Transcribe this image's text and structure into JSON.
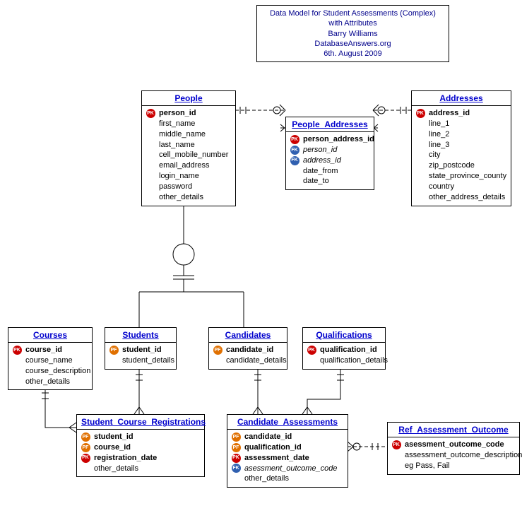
{
  "title": {
    "line1": "Data Model for Student Assessments (Complex)",
    "line2": "with Attributes",
    "line3": "Barry Williams",
    "line4": "DatabaseAnswers.org",
    "line5": "6th. August 2009"
  },
  "entities": {
    "people": {
      "name": "People",
      "attrs": {
        "a0": "person_id",
        "a1": "first_name",
        "a2": "middle_name",
        "a3": "last_name",
        "a4": "cell_mobile_number",
        "a5": "email_address",
        "a6": "login_name",
        "a7": "password",
        "a8": "other_details"
      }
    },
    "people_addresses": {
      "name": "People_Addresses",
      "attrs": {
        "a0": "person_address_id",
        "a1": "person_id",
        "a2": "address_id",
        "a3": "date_from",
        "a4": "date_to"
      }
    },
    "addresses": {
      "name": "Addresses",
      "attrs": {
        "a0": "address_id",
        "a1": "line_1",
        "a2": "line_2",
        "a3": "line_3",
        "a4": "city",
        "a5": "zip_postcode",
        "a6": "state_province_county",
        "a7": "country",
        "a8": "other_address_details"
      }
    },
    "courses": {
      "name": "Courses",
      "attrs": {
        "a0": "course_id",
        "a1": "course_name",
        "a2": "course_description",
        "a3": "other_details"
      }
    },
    "students": {
      "name": "Students",
      "attrs": {
        "a0": "student_id",
        "a1": "student_details"
      }
    },
    "candidates": {
      "name": "Candidates",
      "attrs": {
        "a0": "candidate_id",
        "a1": "candidate_details"
      }
    },
    "qualifications": {
      "name": "Qualifications",
      "attrs": {
        "a0": "qualification_id",
        "a1": "qualification_details"
      }
    },
    "scr": {
      "name": "Student_Course_Registrations",
      "attrs": {
        "a0": "student_id",
        "a1": "course_id",
        "a2": "registration_date",
        "a3": "other_details"
      }
    },
    "ca": {
      "name": "Candidate_Assessments",
      "attrs": {
        "a0": "candidate_id",
        "a1": "qualification_id",
        "a2": "assessment_date",
        "a3": "asessment_outcome_code",
        "a4": "other_details"
      }
    },
    "rao": {
      "name": "Ref_Assessment_Outcome",
      "attrs": {
        "a0": "asessment_outcome_code",
        "a1": "assessment_outcome_description",
        "a2": "eg Pass, Fail"
      }
    }
  },
  "badges": {
    "pk": "PK",
    "pf": "PF",
    "fk": "FK"
  }
}
